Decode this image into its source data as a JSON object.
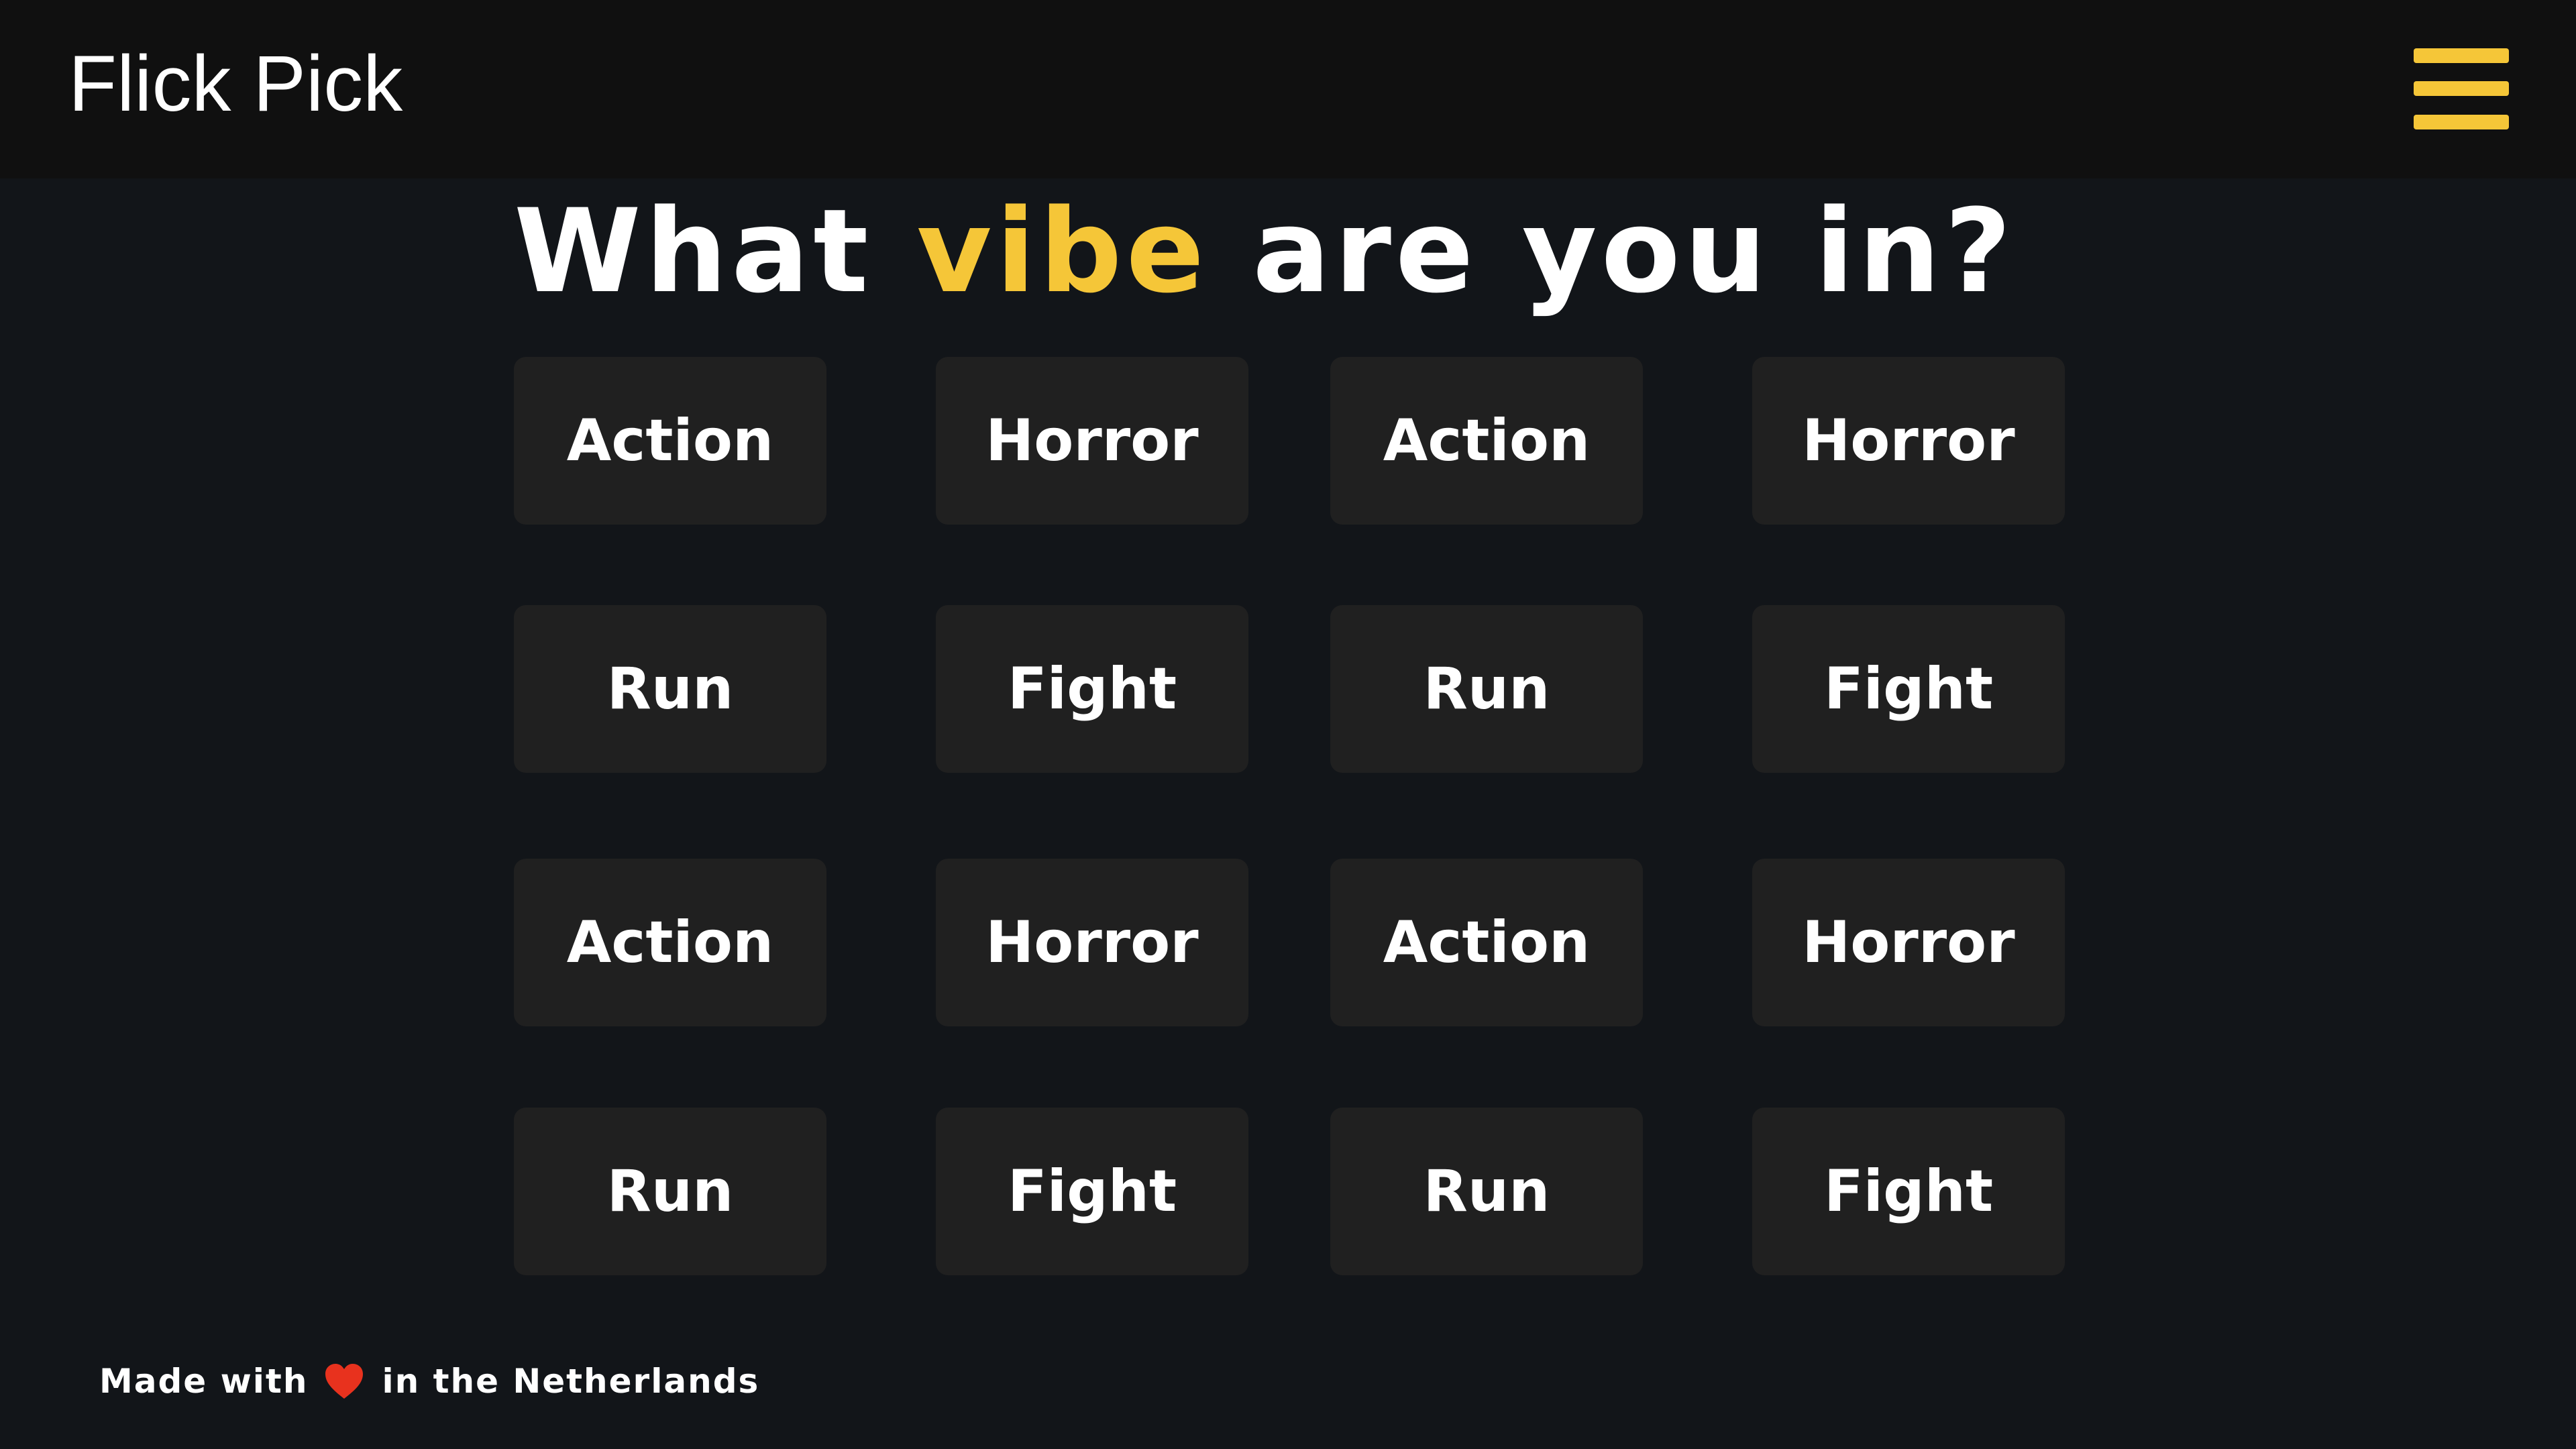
{
  "header": {
    "brand": "Flick Pick",
    "menu_icon": "hamburger-menu-icon"
  },
  "headline": {
    "before": "What ",
    "accent": "vibe",
    "after": " are you in?"
  },
  "genres": [
    [
      "Action",
      "Horror",
      "Action",
      "Horror"
    ],
    [
      "Run",
      "Fight",
      "Run",
      "Fight"
    ],
    [
      "Action",
      "Horror",
      "Action",
      "Horror"
    ],
    [
      "Run",
      "Fight",
      "Run",
      "Fight"
    ]
  ],
  "footer": {
    "before": "Made with",
    "icon": "heart-icon",
    "after": "in the Netherlands"
  },
  "colors": {
    "background": "#121519",
    "header": "#101010",
    "tile": "#202020",
    "accent": "#f5c638",
    "heart": "#e8321e"
  }
}
